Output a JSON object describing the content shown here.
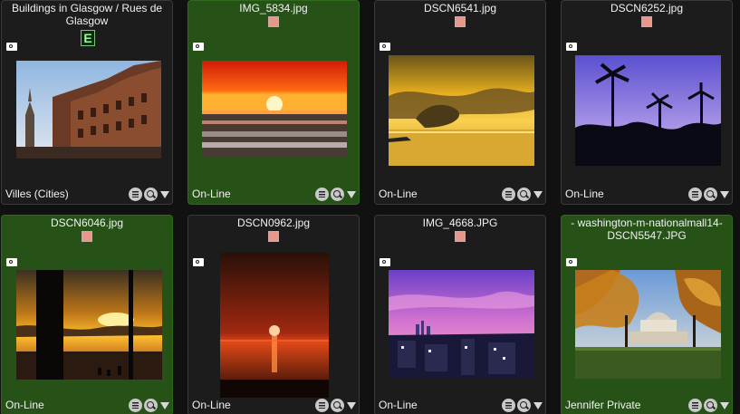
{
  "tiles": [
    {
      "title": "Buildings in Glasgow / Rues de\nGlasgow",
      "marker": "E",
      "footer": "Villes (Cities)",
      "selected": false
    },
    {
      "title": "IMG_5834.jpg",
      "footer": "On-Line",
      "selected": true
    },
    {
      "title": "DSCN6541.jpg",
      "footer": "On-Line",
      "selected": false
    },
    {
      "title": "DSCN6252.jpg",
      "footer": "On-Line",
      "selected": false
    },
    {
      "title": "DSCN6046.jpg",
      "footer": "On-Line",
      "selected": true
    },
    {
      "title": "DSCN0962.jpg",
      "footer": "On-Line",
      "selected": false
    },
    {
      "title": "IMG_4668.JPG",
      "footer": "On-Line",
      "selected": false
    },
    {
      "title": "- washington-m-nationalmall14-\nDSCN5547.JPG",
      "footer": "Jennifer Private",
      "selected": true
    }
  ],
  "icons": {
    "camera": "camera-icon",
    "menu": "menu-icon",
    "zoom": "zoom-icon",
    "dropdown": "dropdown-arrow-icon"
  },
  "colors": {
    "selected_tile": "#265218",
    "tile": "#1c1c1c",
    "badge": "#e8988a"
  }
}
